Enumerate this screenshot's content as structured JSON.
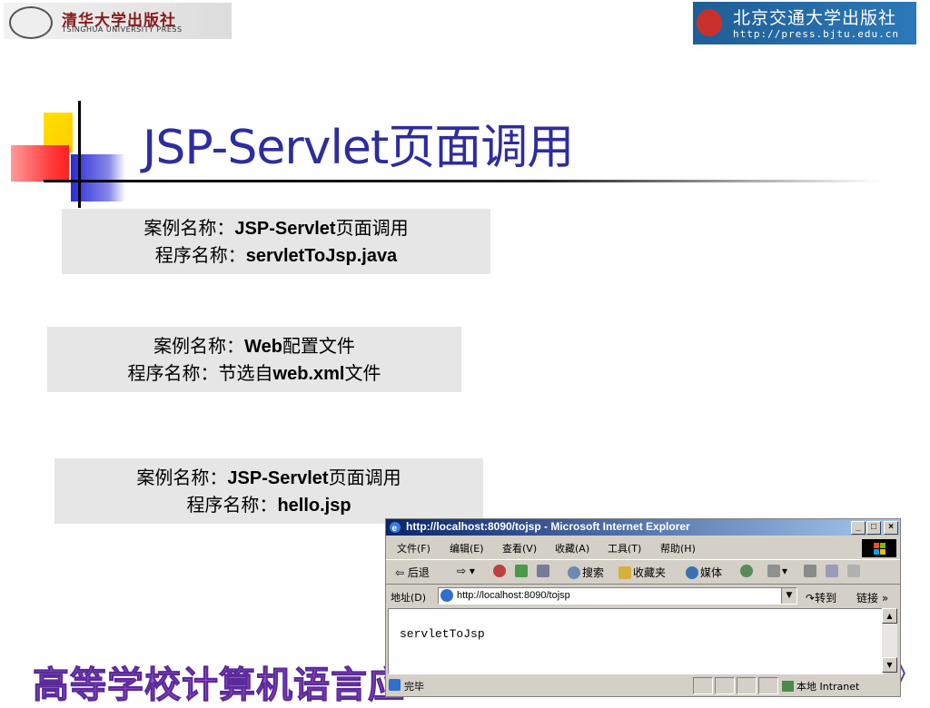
{
  "slide": {
    "title": "JSP-Servlet页面调用",
    "boxes": [
      {
        "line1_prefix": "案例名称：",
        "line1_value": "JSP-Servlet",
        "line1_suffix": "页面调用",
        "line2_prefix": "程序名称：",
        "line2_value": "servletToJsp.java",
        "line2_suffix": ""
      },
      {
        "line1_prefix": "案例名称：",
        "line1_value": "Web",
        "line1_suffix": "配置文件",
        "line2_prefix": "程序名称：节选自",
        "line2_value": "web.xml",
        "line2_suffix": "文件"
      },
      {
        "line1_prefix": "案例名称：",
        "line1_value": "JSP-Servlet",
        "line1_suffix": "页面调用",
        "line2_prefix": "程序名称：",
        "line2_value": "hello.jsp",
        "line2_suffix": ""
      }
    ],
    "footer": "高等学校计算机语言应",
    "footer_end": "》"
  },
  "logos": {
    "left_cn": "清华大学出版社",
    "left_en": "TSINGHUA UNIVERSITY PRESS",
    "right_cn": "北京交通大学出版社",
    "right_url": "http://press.bjtu.edu.cn"
  },
  "browser": {
    "title": "http://localhost:8090/tojsp - Microsoft Internet Explorer",
    "window_buttons": {
      "minimize": "_",
      "maximize": "□",
      "close": "×"
    },
    "menu": [
      "文件(F)",
      "编辑(E)",
      "查看(V)",
      "收藏(A)",
      "工具(T)",
      "帮助(H)"
    ],
    "toolbar": {
      "back": "⇦ 后退",
      "search": "搜索",
      "favorites": "收藏夹",
      "media": "媒体"
    },
    "address_label": "地址(D)",
    "address_value": "http://localhost:8090/tojsp",
    "go_label": "转到",
    "links_label": "链接 »",
    "content_text": "servletToJsp",
    "status_text": "完毕",
    "zone_text": "本地 Intranet",
    "colors": {
      "titlebar_start": "#0a246a",
      "titlebar_end": "#a6caf0",
      "chrome": "#d4d0c8"
    }
  },
  "colors": {
    "title": "#2d2d9e",
    "box_bg": "#e6e6e6",
    "footer": "#a050c8"
  }
}
